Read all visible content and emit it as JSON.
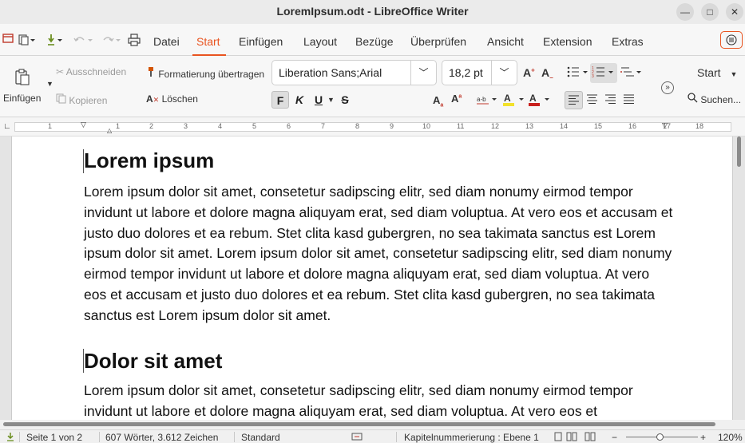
{
  "window": {
    "title": "LoremIpsum.odt - LibreOffice Writer",
    "minimize_glyph": "—",
    "maximize_glyph": "□",
    "close_glyph": "✕"
  },
  "menu": {
    "tabs": [
      {
        "label": "Datei"
      },
      {
        "label": "Start"
      },
      {
        "label": "Einfügen"
      },
      {
        "label": "Layout"
      },
      {
        "label": "Bezüge"
      },
      {
        "label": "Überprüfen"
      },
      {
        "label": "Ansicht"
      },
      {
        "label": "Extension"
      },
      {
        "label": "Extras"
      }
    ],
    "active_tab": "Start",
    "accent_color": "#e95420"
  },
  "ribbon": {
    "paste_label": "Einfügen",
    "cut_label": "Ausschneiden",
    "copy_label": "Kopieren",
    "format_paintbrush_label": "Formatierung übertragen",
    "clear_label": "Löschen",
    "font_name": "Liberation Sans;Arial",
    "font_size": "18,2 pt",
    "bold_label": "F",
    "italic_label": "K",
    "underline_label": "U",
    "strike_label": "S",
    "style_label": "Start",
    "search_label": "Suchen..."
  },
  "ruler": {
    "numbers": [
      "1",
      "1",
      "2",
      "3",
      "4",
      "5",
      "6",
      "7",
      "8",
      "9",
      "10",
      "11",
      "12",
      "13",
      "14",
      "15",
      "16",
      "17",
      "18"
    ]
  },
  "document": {
    "heading1": "Lorem ipsum",
    "paragraph1": "Lorem ipsum dolor sit amet, consetetur sadipscing elitr, sed diam nonumy eirmod tempor invidunt ut labore et dolore magna aliquyam erat, sed diam voluptua. At vero eos et accusam et justo duo dolores et ea rebum. Stet clita kasd gubergren, no sea takimata sanctus est Lorem ipsum dolor sit amet. Lorem ipsum dolor sit amet, consetetur sadipscing elitr, sed diam nonumy eirmod tempor invidunt ut labore et dolore magna aliquyam erat, sed diam voluptua. At vero eos et accusam et justo duo dolores et ea rebum. Stet clita kasd gubergren, no sea takimata sanctus est Lorem ipsum dolor sit amet.",
    "heading2": "Dolor sit amet",
    "paragraph2": "Lorem ipsum dolor sit amet, consetetur sadipscing elitr, sed diam nonumy eirmod tempor invidunt ut labore et dolore magna aliquyam erat, sed diam voluptua. At vero eos et"
  },
  "status": {
    "page": "Seite 1 von 2",
    "words": "607 Wörter, 3.612 Zeichen",
    "page_style": "Standard",
    "outline": "Kapitelnummerierung : Ebene 1",
    "zoom_minus": "−",
    "zoom_plus": "+",
    "zoom": "120%",
    "zoom_level_percent": 120
  }
}
